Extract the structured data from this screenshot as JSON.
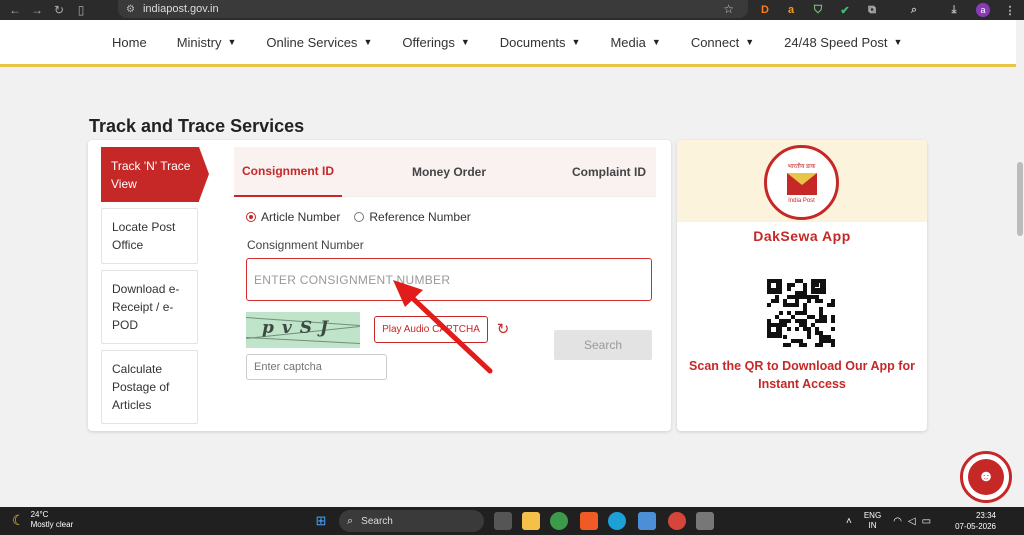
{
  "browser": {
    "url": "indiapost.gov.in",
    "ext_d": "D",
    "ext_a": "a",
    "profile_initial": "a"
  },
  "nav": {
    "items": [
      {
        "label": "Home",
        "has_caret": false
      },
      {
        "label": "Ministry",
        "has_caret": true
      },
      {
        "label": "Online Services",
        "has_caret": true
      },
      {
        "label": "Offerings",
        "has_caret": true
      },
      {
        "label": "Documents",
        "has_caret": true
      },
      {
        "label": "Media",
        "has_caret": true
      },
      {
        "label": "Connect",
        "has_caret": true
      },
      {
        "label": "24/48 Speed Post",
        "has_caret": true
      }
    ]
  },
  "page": {
    "title": "Track and Trace Services"
  },
  "side_menu": {
    "active": "Track 'N' Trace View",
    "items": [
      "Locate Post Office",
      "Download e-Receipt / e-POD",
      "Calculate Postage of Articles"
    ]
  },
  "tabs": {
    "consignment": "Consignment ID",
    "money_order": "Money Order",
    "complaint": "Complaint ID"
  },
  "form": {
    "radio_article": "Article Number",
    "radio_reference": "Reference Number",
    "selected": "Article Number",
    "field_label": "Consignment Number",
    "consignment_placeholder": "ENTER CONSIGNMENT NUMBER",
    "consignment_value": "",
    "captcha_text": "pvSJ",
    "audio_button": "Play Audio CAPTCHA",
    "captcha_placeholder": "Enter captcha",
    "search_button": "Search"
  },
  "app_promo": {
    "logo_hindi": "भारतीय डाक",
    "logo_english": "India Post",
    "title": "DakSewa App",
    "qr_caption": "Scan the QR to Download Our App for Instant Access"
  },
  "taskbar": {
    "temperature": "24°C",
    "weather": "Mostly clear",
    "search": "Search",
    "lang_top": "ENG",
    "lang_bottom": "IN",
    "time": "23:34",
    "date": "07-05-2026"
  },
  "colors": {
    "brand_red": "#c62828",
    "nav_accent": "#e8c547",
    "promo_bg": "#fbf3dc"
  }
}
